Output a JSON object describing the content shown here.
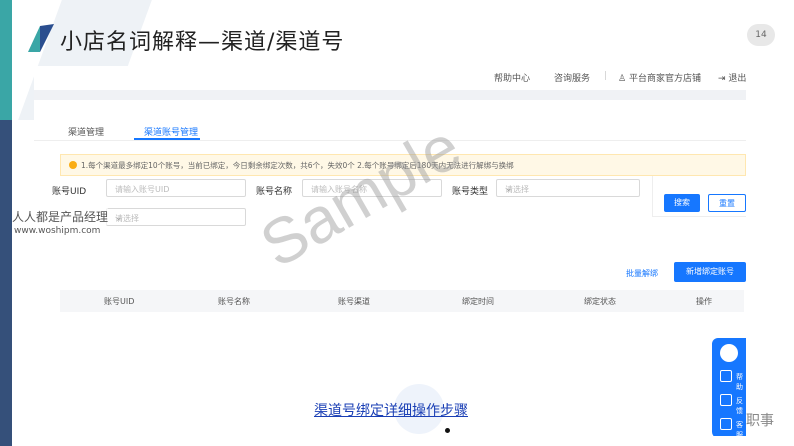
{
  "slide": {
    "title": "小店名词解释—渠道/渠道号",
    "page_number": "14",
    "watermark_site": "人人都是产品经理",
    "watermark_url": "www.woshipm.com",
    "watermark_sample": "Sample",
    "caption_link": "渠道号绑定详细操作步骤",
    "corner_text": "职事"
  },
  "app": {
    "topbar": {
      "help": "帮助中心",
      "service": "咨询服务",
      "user": "平台商家官方店铺",
      "logout": "退出"
    },
    "tabs": [
      {
        "label": "渠道管理",
        "active": false
      },
      {
        "label": "渠道账号管理",
        "active": true
      }
    ],
    "notice": "1.每个渠道最多绑定10个账号，当前已绑定，今日剩余绑定次数，共6个，失效0个 2.每个账号绑定后180天内无法进行解绑与换绑",
    "filters": {
      "account_uid_label": "账号UID",
      "account_uid_placeholder": "请输入账号UID",
      "account_name_label": "账号名称",
      "account_name_placeholder": "请输入账号名称",
      "account_type_label": "账号类型",
      "account_type_placeholder": "请选择",
      "status_placeholder": "请选择"
    },
    "buttons": {
      "search": "搜索",
      "reset": "重置",
      "bind": "新增绑定账号",
      "batch": "批量解绑"
    },
    "table": {
      "columns": [
        "账号UID",
        "账号名称",
        "账号渠道",
        "绑定时间",
        "绑定状态",
        "操作"
      ]
    },
    "side_panel": {
      "items": [
        "帮助",
        "反馈",
        "客服"
      ]
    }
  }
}
